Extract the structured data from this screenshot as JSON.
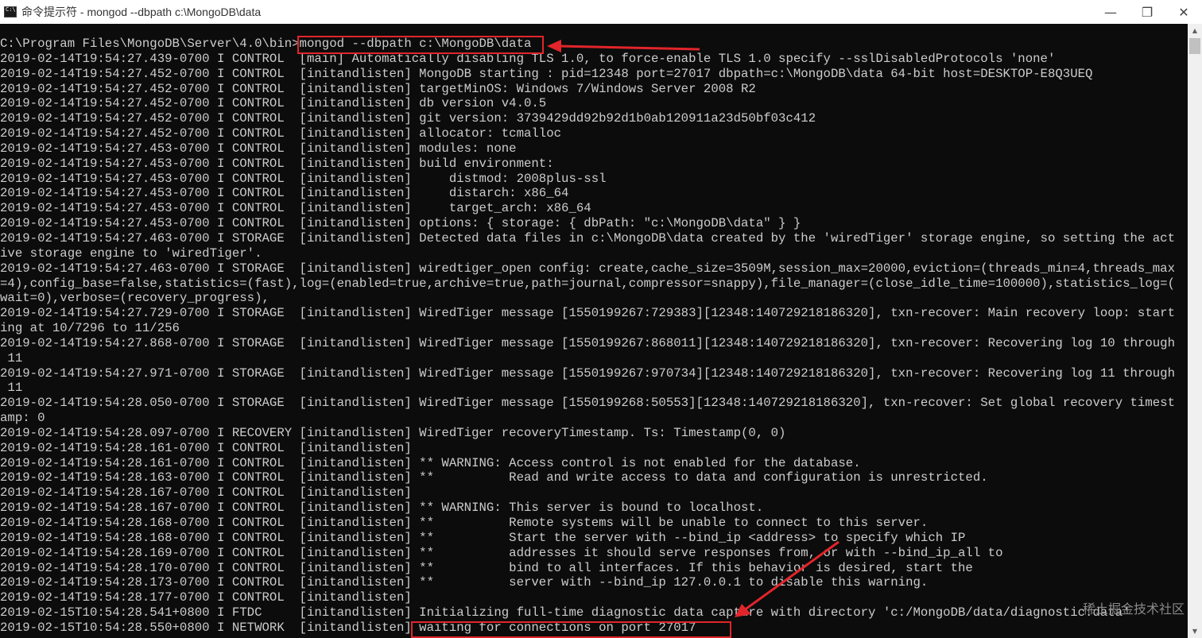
{
  "window": {
    "title": "命令提示符 - mongod  --dbpath c:\\MongoDB\\data",
    "controls": {
      "minimize": "—",
      "restore": "❐",
      "close": "✕"
    }
  },
  "console": {
    "lines": [
      "C:\\Program Files\\MongoDB\\Server\\4.0\\bin>mongod --dbpath c:\\MongoDB\\data",
      "2019-02-14T19:54:27.439-0700 I CONTROL  [main] Automatically disabling TLS 1.0, to force-enable TLS 1.0 specify --sslDisabledProtocols 'none'",
      "2019-02-14T19:54:27.452-0700 I CONTROL  [initandlisten] MongoDB starting : pid=12348 port=27017 dbpath=c:\\MongoDB\\data 64-bit host=DESKTOP-E8Q3UEQ",
      "2019-02-14T19:54:27.452-0700 I CONTROL  [initandlisten] targetMinOS: Windows 7/Windows Server 2008 R2",
      "2019-02-14T19:54:27.452-0700 I CONTROL  [initandlisten] db version v4.0.5",
      "2019-02-14T19:54:27.452-0700 I CONTROL  [initandlisten] git version: 3739429dd92b92d1b0ab120911a23d50bf03c412",
      "2019-02-14T19:54:27.452-0700 I CONTROL  [initandlisten] allocator: tcmalloc",
      "2019-02-14T19:54:27.453-0700 I CONTROL  [initandlisten] modules: none",
      "2019-02-14T19:54:27.453-0700 I CONTROL  [initandlisten] build environment:",
      "2019-02-14T19:54:27.453-0700 I CONTROL  [initandlisten]     distmod: 2008plus-ssl",
      "2019-02-14T19:54:27.453-0700 I CONTROL  [initandlisten]     distarch: x86_64",
      "2019-02-14T19:54:27.453-0700 I CONTROL  [initandlisten]     target_arch: x86_64",
      "2019-02-14T19:54:27.453-0700 I CONTROL  [initandlisten] options: { storage: { dbPath: \"c:\\MongoDB\\data\" } }",
      "2019-02-14T19:54:27.463-0700 I STORAGE  [initandlisten] Detected data files in c:\\MongoDB\\data created by the 'wiredTiger' storage engine, so setting the act",
      "ive storage engine to 'wiredTiger'.",
      "2019-02-14T19:54:27.463-0700 I STORAGE  [initandlisten] wiredtiger_open config: create,cache_size=3509M,session_max=20000,eviction=(threads_min=4,threads_max",
      "=4),config_base=false,statistics=(fast),log=(enabled=true,archive=true,path=journal,compressor=snappy),file_manager=(close_idle_time=100000),statistics_log=(",
      "wait=0),verbose=(recovery_progress),",
      "2019-02-14T19:54:27.729-0700 I STORAGE  [initandlisten] WiredTiger message [1550199267:729383][12348:140729218186320], txn-recover: Main recovery loop: start",
      "ing at 10/7296 to 11/256",
      "2019-02-14T19:54:27.868-0700 I STORAGE  [initandlisten] WiredTiger message [1550199267:868011][12348:140729218186320], txn-recover: Recovering log 10 through",
      " 11",
      "2019-02-14T19:54:27.971-0700 I STORAGE  [initandlisten] WiredTiger message [1550199267:970734][12348:140729218186320], txn-recover: Recovering log 11 through",
      " 11",
      "2019-02-14T19:54:28.050-0700 I STORAGE  [initandlisten] WiredTiger message [1550199268:50553][12348:140729218186320], txn-recover: Set global recovery timest",
      "amp: 0",
      "2019-02-14T19:54:28.097-0700 I RECOVERY [initandlisten] WiredTiger recoveryTimestamp. Ts: Timestamp(0, 0)",
      "2019-02-14T19:54:28.161-0700 I CONTROL  [initandlisten]",
      "2019-02-14T19:54:28.161-0700 I CONTROL  [initandlisten] ** WARNING: Access control is not enabled for the database.",
      "2019-02-14T19:54:28.163-0700 I CONTROL  [initandlisten] **          Read and write access to data and configuration is unrestricted.",
      "2019-02-14T19:54:28.167-0700 I CONTROL  [initandlisten]",
      "2019-02-14T19:54:28.167-0700 I CONTROL  [initandlisten] ** WARNING: This server is bound to localhost.",
      "2019-02-14T19:54:28.168-0700 I CONTROL  [initandlisten] **          Remote systems will be unable to connect to this server.",
      "2019-02-14T19:54:28.168-0700 I CONTROL  [initandlisten] **          Start the server with --bind_ip <address> to specify which IP",
      "2019-02-14T19:54:28.169-0700 I CONTROL  [initandlisten] **          addresses it should serve responses from, or with --bind_ip_all to",
      "2019-02-14T19:54:28.170-0700 I CONTROL  [initandlisten] **          bind to all interfaces. If this behavior is desired, start the",
      "2019-02-14T19:54:28.173-0700 I CONTROL  [initandlisten] **          server with --bind_ip 127.0.0.1 to disable this warning.",
      "2019-02-14T19:54:28.177-0700 I CONTROL  [initandlisten]",
      "2019-02-15T10:54:28.541+0800 I FTDC     [initandlisten] Initializing full-time diagnostic data capture with directory 'c:/MongoDB/data/diagnostic.data'",
      "2019-02-15T10:54:28.550+0800 I NETWORK  [initandlisten] waiting for connections on port 27017"
    ]
  },
  "scrollbar": {
    "up_icon": "▲",
    "down_icon": "▼"
  },
  "annotations": {
    "highlight_color": "#e1252b"
  },
  "watermark": "稀土掘金技术社区"
}
